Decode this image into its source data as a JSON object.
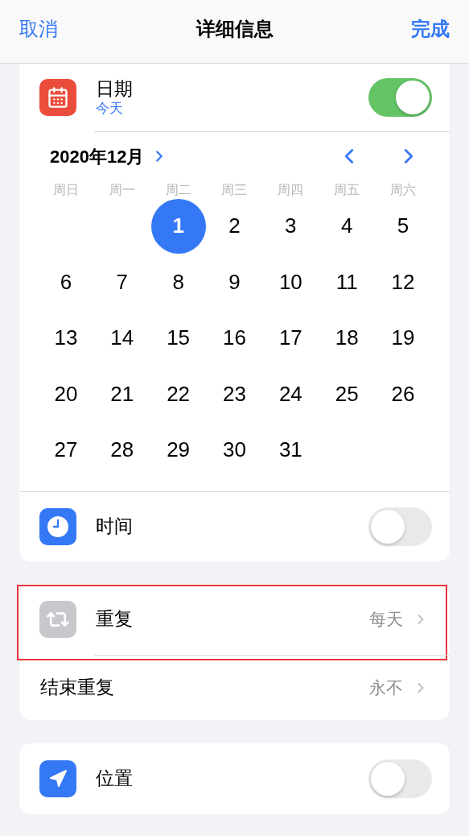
{
  "nav": {
    "cancel": "取消",
    "title": "详细信息",
    "done": "完成"
  },
  "date_row": {
    "label": "日期",
    "sublabel": "今天",
    "on": true
  },
  "calendar": {
    "month": "2020年12月",
    "weekdays": [
      "周日",
      "周一",
      "周二",
      "周三",
      "周四",
      "周五",
      "周六"
    ],
    "weeks": [
      [
        {
          "kind": "empty"
        },
        {
          "kind": "empty"
        },
        {
          "kind": "day",
          "label": "1",
          "selected": true
        },
        {
          "kind": "day",
          "label": "2",
          "selected": false
        },
        {
          "kind": "day",
          "label": "3",
          "selected": false
        },
        {
          "kind": "day",
          "label": "4",
          "selected": false
        },
        {
          "kind": "day",
          "label": "5",
          "selected": false
        }
      ],
      [
        {
          "kind": "day",
          "label": "6",
          "selected": false
        },
        {
          "kind": "day",
          "label": "7",
          "selected": false
        },
        {
          "kind": "day",
          "label": "8",
          "selected": false
        },
        {
          "kind": "day",
          "label": "9",
          "selected": false
        },
        {
          "kind": "day",
          "label": "10",
          "selected": false
        },
        {
          "kind": "day",
          "label": "11",
          "selected": false
        },
        {
          "kind": "day",
          "label": "12",
          "selected": false
        }
      ],
      [
        {
          "kind": "day",
          "label": "13",
          "selected": false
        },
        {
          "kind": "day",
          "label": "14",
          "selected": false
        },
        {
          "kind": "day",
          "label": "15",
          "selected": false
        },
        {
          "kind": "day",
          "label": "16",
          "selected": false
        },
        {
          "kind": "day",
          "label": "17",
          "selected": false
        },
        {
          "kind": "day",
          "label": "18",
          "selected": false
        },
        {
          "kind": "day",
          "label": "19",
          "selected": false
        }
      ],
      [
        {
          "kind": "day",
          "label": "20",
          "selected": false
        },
        {
          "kind": "day",
          "label": "21",
          "selected": false
        },
        {
          "kind": "day",
          "label": "22",
          "selected": false
        },
        {
          "kind": "day",
          "label": "23",
          "selected": false
        },
        {
          "kind": "day",
          "label": "24",
          "selected": false
        },
        {
          "kind": "day",
          "label": "25",
          "selected": false
        },
        {
          "kind": "day",
          "label": "26",
          "selected": false
        }
      ],
      [
        {
          "kind": "day",
          "label": "27",
          "selected": false
        },
        {
          "kind": "day",
          "label": "28",
          "selected": false
        },
        {
          "kind": "day",
          "label": "29",
          "selected": false
        },
        {
          "kind": "day",
          "label": "30",
          "selected": false
        },
        {
          "kind": "day",
          "label": "31",
          "selected": false
        },
        {
          "kind": "empty"
        },
        {
          "kind": "empty"
        }
      ]
    ]
  },
  "time_row": {
    "label": "时间",
    "on": false
  },
  "repeat_rows": [
    {
      "kind": "icon",
      "label": "重复",
      "value": "每天",
      "highlighted": true
    },
    {
      "kind": "plain",
      "label": "结束重复",
      "value": "永不",
      "highlighted": false
    }
  ],
  "location_row": {
    "label": "位置",
    "on": false
  }
}
